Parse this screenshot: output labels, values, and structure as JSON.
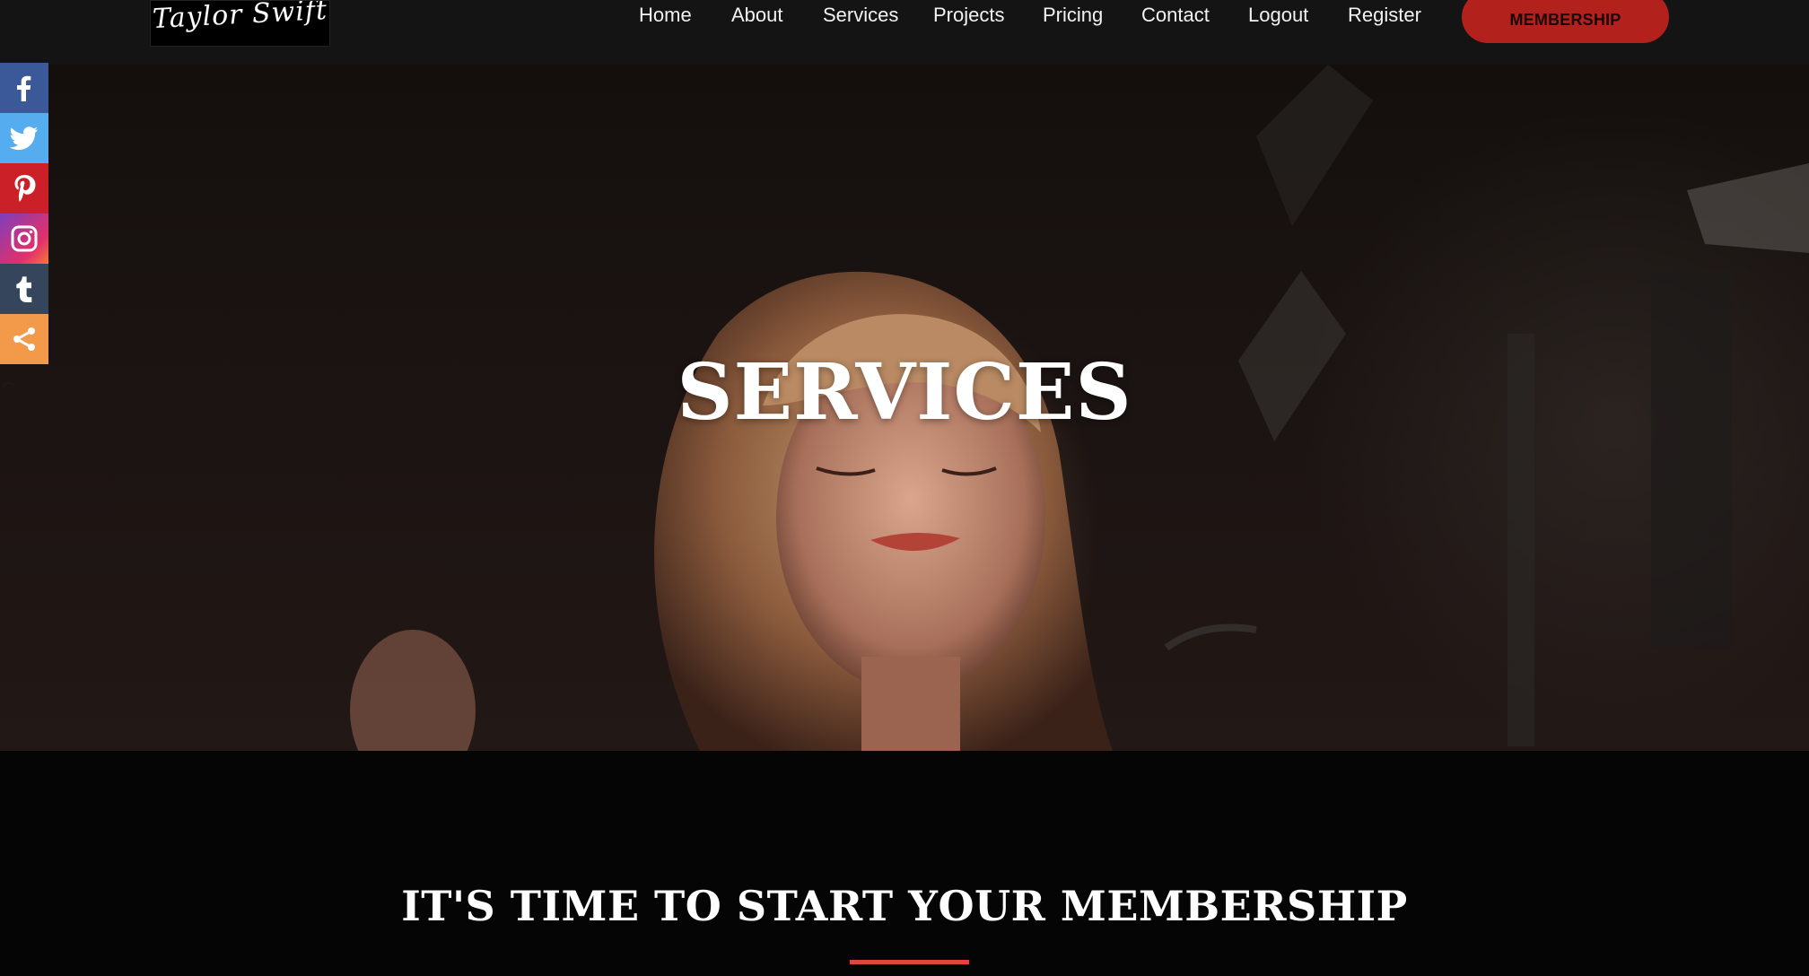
{
  "header": {
    "logo_text": "Taylor Swift",
    "nav": [
      {
        "label": "Home"
      },
      {
        "label": "About"
      },
      {
        "label": "Services"
      },
      {
        "label": "Projects"
      },
      {
        "label": "Pricing"
      },
      {
        "label": "Contact"
      },
      {
        "label": "Logout"
      },
      {
        "label": "Register"
      }
    ],
    "cta_label": "MEMBERSHIP"
  },
  "social": [
    {
      "icon": "facebook-icon",
      "color": "#3b5998"
    },
    {
      "icon": "twitter-icon",
      "color": "#55acee"
    },
    {
      "icon": "pinterest-icon",
      "color": "#cb2027"
    },
    {
      "icon": "instagram-icon",
      "color": "#c13584"
    },
    {
      "icon": "tumblr-icon",
      "color": "#35465c"
    },
    {
      "icon": "share-icon",
      "color": "#f29a4a"
    }
  ],
  "hero": {
    "title": "SERVICES"
  },
  "membership": {
    "title": "IT'S TIME TO START YOUR MEMBERSHIP",
    "accent_color": "#e0463a"
  },
  "colors": {
    "cta": "#b3211c",
    "header_bg": "#141414",
    "page_bg": "#050505"
  }
}
